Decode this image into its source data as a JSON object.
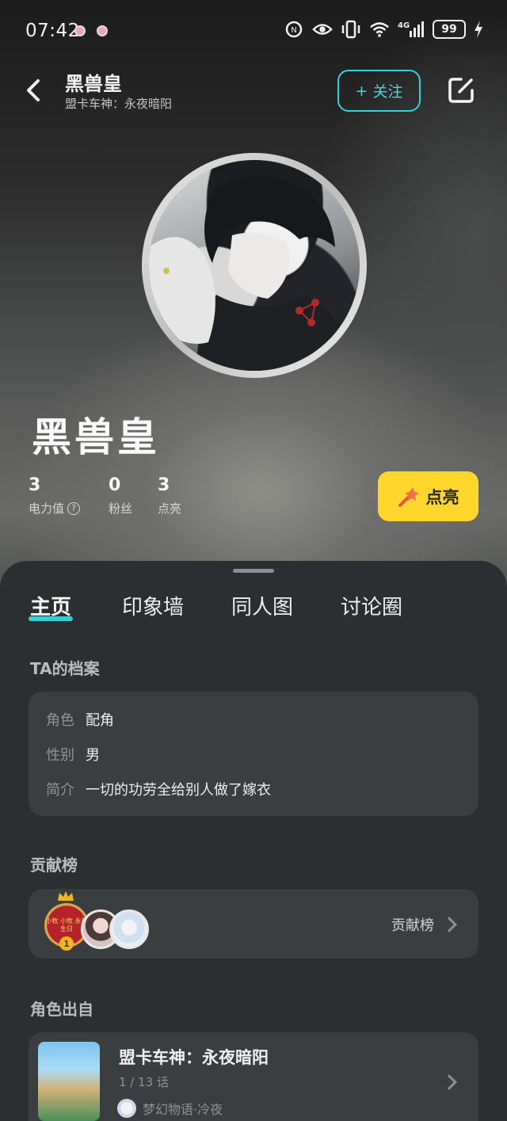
{
  "status_bar": {
    "time": "07:42",
    "battery": "99",
    "network": "4G"
  },
  "header": {
    "title": "黑兽皇",
    "subtitle": "盟卡车神：永夜暗阳",
    "follow_label": "关注",
    "follow_prefix": "+"
  },
  "profile": {
    "name": "黑兽皇",
    "stats": [
      {
        "value": "3",
        "label": "电力值"
      },
      {
        "value": "0",
        "label": "粉丝"
      },
      {
        "value": "3",
        "label": "点亮"
      }
    ],
    "light_button": "点亮"
  },
  "tabs": [
    {
      "label": "主页",
      "active": true
    },
    {
      "label": "印象墙",
      "active": false
    },
    {
      "label": "同人图",
      "active": false
    },
    {
      "label": "讨论圈",
      "active": false
    }
  ],
  "archive": {
    "title": "TA的档案",
    "rows": [
      {
        "key": "角色",
        "value": "配角"
      },
      {
        "key": "性别",
        "value": "男"
      },
      {
        "key": "简介",
        "value": "一切的功劳全给别人做了嫁衣"
      }
    ]
  },
  "contribution": {
    "title": "贡献榜",
    "link_label": "贡献榜",
    "rank1_text": "小牧 小牧 永夜 生日",
    "rank1_number": "1"
  },
  "origin": {
    "title": "角色出自",
    "work_title": "盟卡车神：永夜暗阳",
    "progress": "1 / 13 话",
    "author": "梦幻物语·冷夜"
  },
  "colors": {
    "accent": "#35cdd2",
    "light_button": "#ffd62c",
    "sheet": "#2b2f31",
    "card": "#3a3e40"
  }
}
